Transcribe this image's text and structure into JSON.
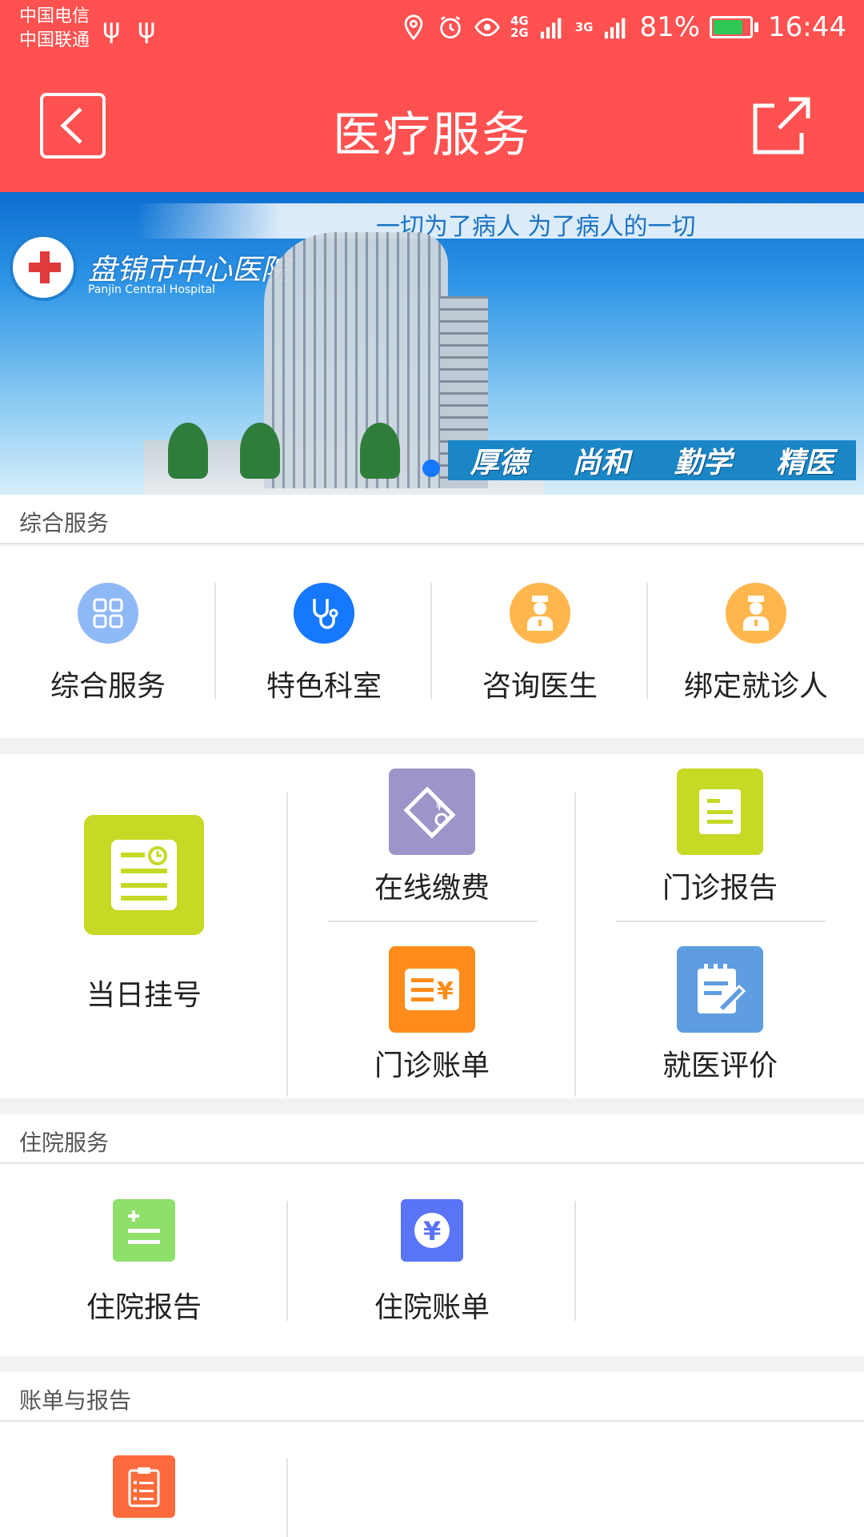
{
  "status_bar": {
    "carrier_1": "中国电信",
    "carrier_2": "中国联通",
    "usb_1": "ψ",
    "usb_2": "ψ",
    "net_4g": "4G",
    "net_2g": "2G",
    "net_3g": "3G",
    "battery_percent": "81%",
    "time": "16:44"
  },
  "header": {
    "title": "医疗服务"
  },
  "banner": {
    "slogan": "一切为了病人 为了病人的一切",
    "hospital_name": "盘锦市中心医院",
    "hospital_name_en": "Panjin Central Hospital",
    "motto": [
      "厚德",
      "尚和",
      "勤学",
      "精医"
    ]
  },
  "sections": {
    "general": {
      "label": "综合服务",
      "items": [
        {
          "label": "综合服务",
          "icon": "grid-icon",
          "color": "#8fb8f6"
        },
        {
          "label": "特色科室",
          "icon": "stethoscope-icon",
          "color": "#1677ff"
        },
        {
          "label": "咨询医生",
          "icon": "doctor-icon",
          "color": "#ffb74d"
        },
        {
          "label": "绑定就诊人",
          "icon": "doctor-icon",
          "color": "#ffb74d"
        }
      ]
    },
    "outpatient": {
      "big_item": {
        "label": "当日挂号",
        "icon": "registration-icon",
        "color": "#c5d925"
      },
      "items": [
        {
          "label": "在线缴费",
          "icon": "payment-card-icon",
          "color": "#9d95c9"
        },
        {
          "label": "门诊报告",
          "icon": "report-icon",
          "color": "#c5d925"
        },
        {
          "label": "门诊账单",
          "icon": "bill-icon",
          "color": "#ff8c1a"
        },
        {
          "label": "就医评价",
          "icon": "evaluation-icon",
          "color": "#5e9de0"
        }
      ]
    },
    "inpatient": {
      "label": "住院服务",
      "items": [
        {
          "label": "住院报告",
          "icon": "inpatient-report-icon",
          "color": "#8fe06a"
        },
        {
          "label": "住院账单",
          "icon": "yen-icon",
          "color": "#5a74f7"
        }
      ]
    },
    "bills": {
      "label": "账单与报告",
      "items": [
        {
          "icon": "checklist-icon",
          "color": "#ff6b3d"
        }
      ]
    }
  }
}
